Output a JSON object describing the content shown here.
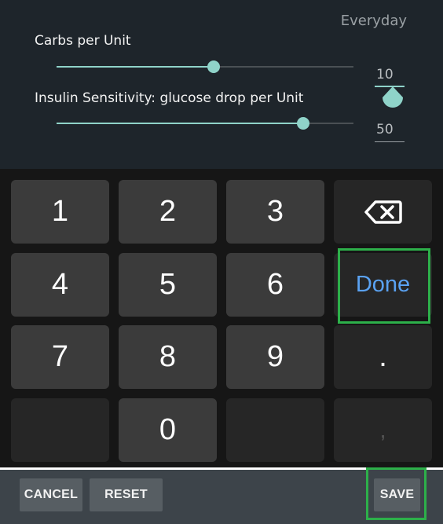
{
  "settings": {
    "schedule_label": "Everyday",
    "carbs": {
      "label": "Carbs per Unit",
      "value": "10",
      "slider_fraction": 0.53
    },
    "sensitivity": {
      "label": "Insulin Sensitivity: glucose drop per Unit",
      "value": "50",
      "slider_fraction": 0.83
    },
    "accent_color": "#8fd3c9"
  },
  "keypad": {
    "keys": [
      "1",
      "2",
      "3",
      "4",
      "5",
      "6",
      "7",
      "8",
      "9",
      "0",
      ".",
      ","
    ],
    "backspace_icon": "backspace-icon",
    "done_label": "Done",
    "done_color": "#5aa2f2"
  },
  "actions": {
    "cancel_label": "CANCEL",
    "reset_label": "RESET",
    "save_label": "SAVE"
  },
  "highlight_color": "#2db04a"
}
